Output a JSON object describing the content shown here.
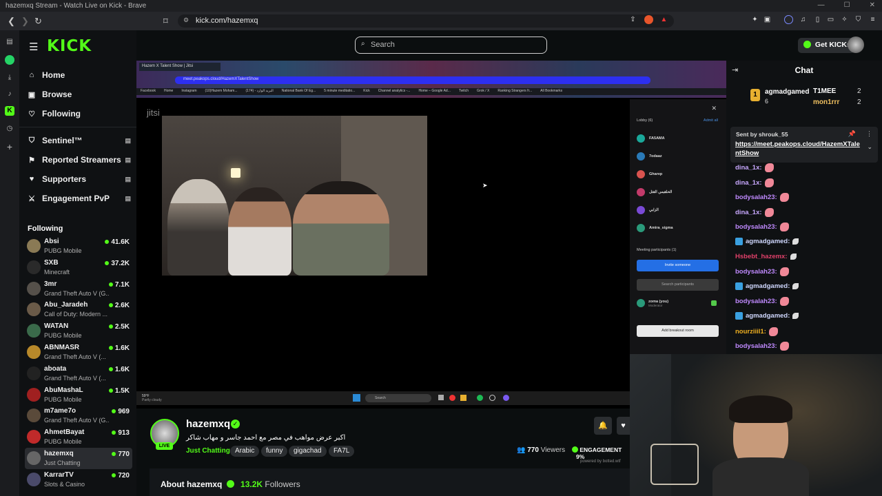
{
  "window": {
    "title": "hazemxq Stream - Watch Live on Kick - Brave"
  },
  "browser": {
    "url": "kick.com/hazemxq"
  },
  "brand": {
    "logo": "KICK",
    "accent": "#53fc18"
  },
  "search": {
    "placeholder": "Search"
  },
  "header": {
    "get_kicks": "Get KICKs"
  },
  "nav": {
    "items": [
      {
        "label": "Home",
        "icon": "home-icon"
      },
      {
        "label": "Browse",
        "icon": "browse-icon"
      },
      {
        "label": "Following",
        "icon": "heart-icon"
      }
    ],
    "extensions": [
      {
        "label": "Sentinel™",
        "icon": "shield-icon"
      },
      {
        "label": "Reported Streamers",
        "icon": "flag-icon"
      },
      {
        "label": "Supporters",
        "icon": "heart-icon"
      },
      {
        "label": "Engagement PvP",
        "icon": "swords-icon"
      }
    ]
  },
  "following": {
    "heading": "Following",
    "channels": [
      {
        "name": "Absi",
        "game": "PUBG Mobile",
        "viewers": "41.6K",
        "color": "#8a7a55"
      },
      {
        "name": "SXB",
        "game": "Minecraft",
        "viewers": "37.2K",
        "color": "#2a2a2a"
      },
      {
        "name": "3mr",
        "game": "Grand Theft Auto V (G...",
        "viewers": "7.1K",
        "color": "#55504a"
      },
      {
        "name": "Abu_Jaradeh",
        "game": "Call of Duty: Modern ...",
        "viewers": "2.6K",
        "color": "#6a5a48"
      },
      {
        "name": "WATAN",
        "game": "PUBG Mobile",
        "viewers": "2.5K",
        "color": "#3a6a4a"
      },
      {
        "name": "ABNMASR",
        "game": "Grand Theft Auto V (...",
        "viewers": "1.6K",
        "color": "#b8892a"
      },
      {
        "name": "aboata",
        "game": "Grand Theft Auto V (...",
        "viewers": "1.6K",
        "color": "#222222"
      },
      {
        "name": "AbuMashaL",
        "game": "PUBG Mobile",
        "viewers": "1.5K",
        "color": "#a02020"
      },
      {
        "name": "m7ame7o",
        "game": "Grand Theft Auto V (G...",
        "viewers": "969",
        "color": "#5a4a3a"
      },
      {
        "name": "AhmetBayat",
        "game": "PUBG Mobile",
        "viewers": "913",
        "color": "#c02a2a"
      },
      {
        "name": "hazemxq",
        "game": "Just Chatting",
        "viewers": "770",
        "color": "#666666"
      },
      {
        "name": "KarrarTV",
        "game": "Slots & Casino",
        "viewers": "720",
        "color": "#4a4a6a"
      }
    ]
  },
  "player": {
    "inner_tab": "Hazem X Talent Show | Jitsi",
    "inner_url": "meet.peakops.cloud/HazemXTalentShow",
    "bookmarks": [
      "Facebook",
      "Home",
      "Instagram",
      "(10)Hazem Moham...",
      "(174) - البريد الوارد",
      "National Bank Of Eg...",
      "5 minute meditatio...",
      "Kick",
      "Channel analytics -...",
      "Home – Google Ad...",
      "Twitch",
      "Grok / X",
      "Ranking Strangers fr...",
      "All Bookmarks"
    ],
    "jitsi_logo": "jitsi",
    "lobby": {
      "title": "Lobby (6)",
      "admit_all": "Admit all",
      "people": [
        {
          "name": "FA5AMA",
          "initial": "F",
          "color": "#1aa89a"
        },
        {
          "name": "7odaaz",
          "initial": "7",
          "color": "#2a7ab8"
        },
        {
          "name": "Gharep",
          "initial": "G",
          "color": "#d9534f"
        },
        {
          "name": "الحلقبس القتل",
          "initial": "ا",
          "color": "#c23a6a"
        },
        {
          "name": "الزابي",
          "initial": "ا",
          "color": "#7a4ad6"
        },
        {
          "name": "Amira_sigma",
          "initial": "AS",
          "color": "#2a9a7a"
        }
      ],
      "participants_title": "Meeting participants (1)",
      "invite": "Invite someone",
      "search_participants": "Search participants",
      "me_name": "zoma (you)",
      "me_role": "Moderator",
      "breakout": "Add breakout room"
    },
    "taskbar": {
      "weather": "59°F",
      "weather_sub": "Partly cloudy",
      "search": "Search"
    }
  },
  "chat": {
    "title": "Chat",
    "leaderboard": [
      {
        "rank": "1",
        "name": "agmadgamed",
        "count": "6"
      },
      {
        "name": "T1MEE",
        "count": "2"
      },
      {
        "name": "mon1rrr",
        "count": "2"
      }
    ],
    "pinned": {
      "sent_by": "Sent by shrouk_55",
      "link": "https://meet.peakops.cloud/HazemXTalentShow"
    },
    "messages": [
      {
        "user": "dina_1x:",
        "color": "#c8a8ff",
        "emote": "emote"
      },
      {
        "user": "dina_1x:",
        "color": "#c8a8ff",
        "emote": "emote"
      },
      {
        "user": "bodysalah23:",
        "color": "#c08aff",
        "emote": "emote"
      },
      {
        "user": "dina_1x:",
        "color": "#c8a8ff",
        "emote": "emote"
      },
      {
        "user": "bodysalah23:",
        "color": "#c08aff",
        "emote": "emote"
      },
      {
        "user": "agmadgamed:",
        "color": "#d0d8ff",
        "emote": "feather"
      },
      {
        "user": "Hsbebt_hazemx:",
        "color": "#e0406a",
        "emote": "feather"
      },
      {
        "user": "bodysalah23:",
        "color": "#c08aff",
        "emote": "emote"
      },
      {
        "user": "agmadgamed:",
        "color": "#d0d8ff",
        "emote": "feather"
      },
      {
        "user": "bodysalah23:",
        "color": "#c08aff",
        "emote": "emote"
      },
      {
        "user": "agmadgamed:",
        "color": "#d0d8ff",
        "emote": "feather"
      },
      {
        "user": "nourziiil1:",
        "color": "#f0b020",
        "emote": "emote"
      },
      {
        "user": "bodysalah23:",
        "color": "#c08aff",
        "emote": "emote"
      }
    ]
  },
  "stream": {
    "name": "hazemxq",
    "live": "LIVE",
    "title": "اكبر عرض مواهب في مصر مع احمد جاسر و مهاب شاكر",
    "category": "Just Chatting",
    "tags": [
      "Arabic",
      "funny",
      "gigachad",
      "FA7L"
    ],
    "viewers": "770",
    "viewers_label": "Viewers",
    "engagement_label": "ENGAGEMENT",
    "engagement_value": "9%",
    "powered": "powered by botted.wtf",
    "about": "About hazemxq",
    "followers_count": "13.2K",
    "followers_label": "Followers"
  }
}
